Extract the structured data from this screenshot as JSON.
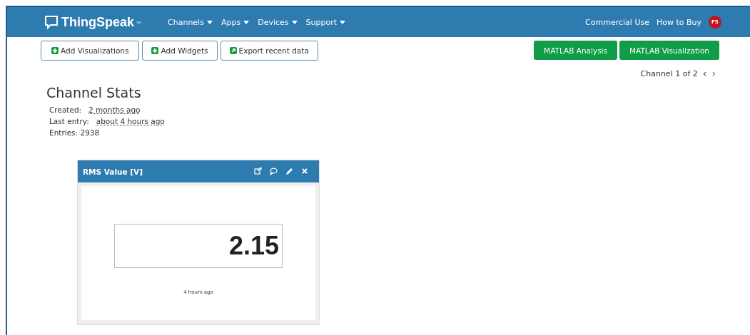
{
  "navbar": {
    "brand": "ThingSpeak",
    "trademark": "™",
    "menus": [
      {
        "label": "Channels"
      },
      {
        "label": "Apps"
      },
      {
        "label": "Devices"
      },
      {
        "label": "Support"
      }
    ],
    "links": [
      "Commercial Use",
      "How to Buy"
    ],
    "avatar": "FS"
  },
  "toolbar": {
    "buttons": [
      {
        "label": "Add Visualizations",
        "kind": "add"
      },
      {
        "label": "Add Widgets",
        "kind": "add"
      },
      {
        "label": "Export recent data",
        "kind": "export"
      }
    ],
    "matlab_buttons": [
      "MATLAB Analysis",
      "MATLAB Visualization"
    ]
  },
  "pager": {
    "text": "Channel 1 of 2",
    "prev": "‹",
    "next": "›"
  },
  "stats": {
    "title": "Channel Stats",
    "rows": [
      {
        "label": "Created:",
        "value": "2 months ago"
      },
      {
        "label": "Last entry:",
        "value": "about 4 hours ago"
      },
      {
        "label": "Entries: 2938"
      }
    ]
  },
  "widget": {
    "title": "RMS Value [V]",
    "value": "2.15",
    "time": "4 hours ago"
  }
}
